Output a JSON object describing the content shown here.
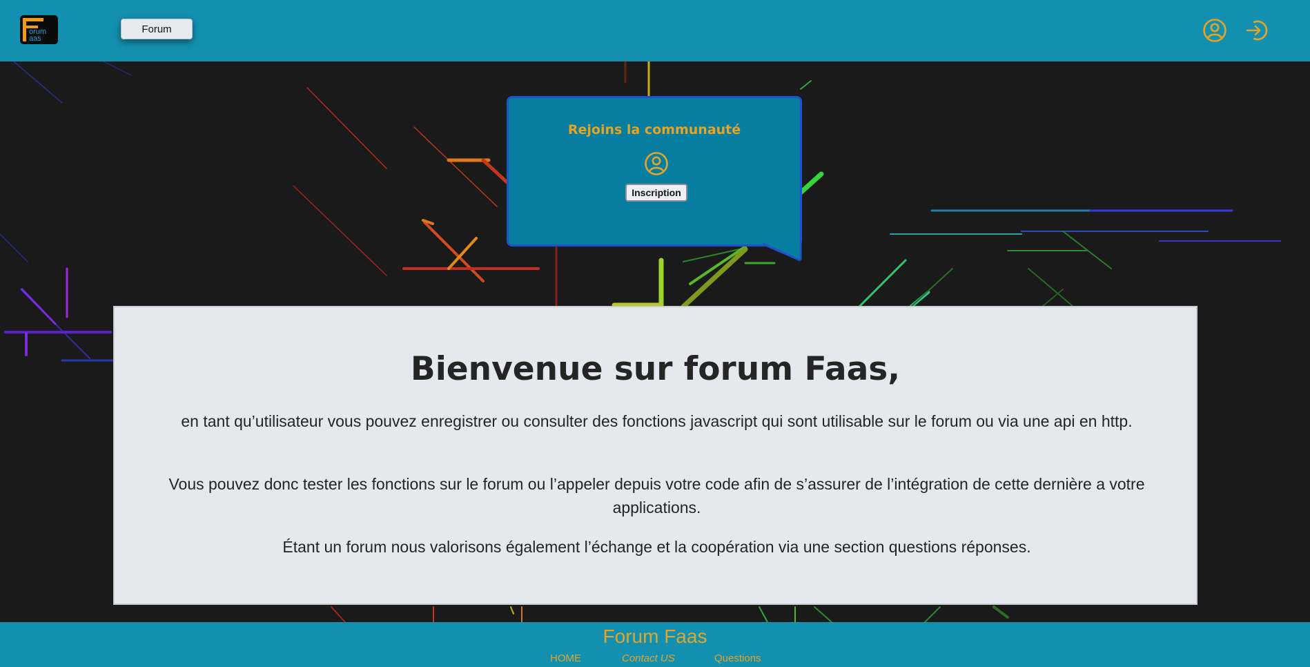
{
  "header": {
    "logo": {
      "line1": "orum",
      "line2": "aas",
      "letter": "F"
    },
    "forum_button": "Forum",
    "icons": [
      "user-circle-icon",
      "sign-in-icon"
    ]
  },
  "bubble": {
    "title": "Rejoins la communauté",
    "icon": "user-circle-icon",
    "button": "Inscription"
  },
  "welcome": {
    "title": "Bienvenue sur forum Faas,",
    "paragraphs": [
      "en tant qu’utilisateur vous pouvez enregistrer ou consulter des fonctions javascript qui sont utilisable sur le forum ou via une api en http.",
      "Vous pouvez donc tester les fonctions sur le forum ou l’appeler depuis votre code afin de s’assurer de l’intégration de cette dernière a votre applications.",
      "Étant un forum nous valorisons également l’échange et la coopération via une section questions réponses."
    ]
  },
  "footer": {
    "title": "Forum Faas",
    "links": [
      "HOME",
      "Contact US",
      "Questions"
    ]
  },
  "colors": {
    "header_bg": "#1390b0",
    "accent": "#e4a428",
    "bubble_bg": "#077e9f",
    "bubble_border": "#1d52cc",
    "card_bg": "#e5e8ed",
    "page_bg": "#1a1a1a"
  }
}
